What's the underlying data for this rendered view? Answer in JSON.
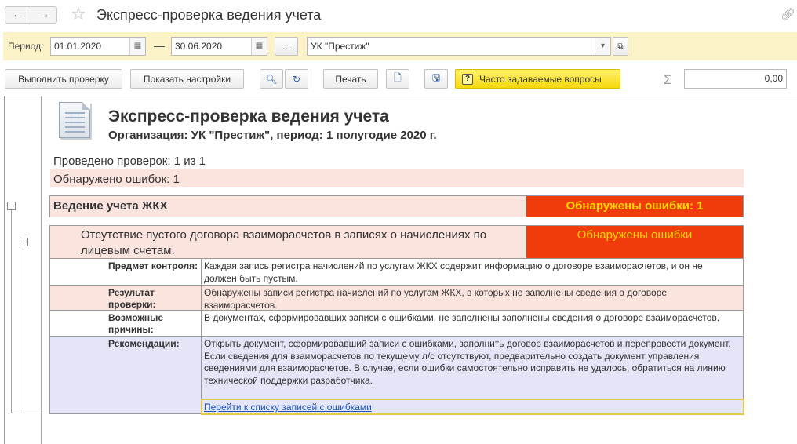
{
  "window": {
    "title": "Экспресс-проверка ведения учета"
  },
  "filter": {
    "period_label": "Период:",
    "date_from": "01.01.2020",
    "date_to": "30.06.2020",
    "dash": "—",
    "ellipsis_button": "...",
    "organization": "УК \"Престиж\""
  },
  "toolbar": {
    "run_check": "Выполнить проверку",
    "show_settings": "Показать настройки",
    "print": "Печать",
    "faq": "Часто задаваемые вопросы",
    "sum_value": "0,00"
  },
  "report": {
    "title": "Экспресс-проверка ведения учета",
    "org_line": "Организация: УК \"Престиж\", период: 1 полугодие 2020 г.",
    "checks_done": "Проведено проверок: 1 из 1",
    "errors_found": "Обнаружено ошибок: 1",
    "section": {
      "name": "Ведение учета ЖКХ",
      "status": "Обнаружены ошибки: 1"
    },
    "check": {
      "name": "Отсутствие пустого договора взаиморасчетов в записях о начислениях по лицевым счетам.",
      "status": "Обнаружены ошибки",
      "rows": [
        {
          "key": "Предмет контроля:",
          "value": "Каждая запись регистра начислений по услугам ЖКХ содержит информацию о договоре взаиморасчетов, и он не должен быть пустым."
        },
        {
          "key": "Результат проверки:",
          "value": "Обнаружены записи регистра начислений по услугам ЖКХ, в которых не заполнены сведения о договоре взаиморасчетов."
        },
        {
          "key": "Возможные причины:",
          "value": "В документах, сформировавших записи с ошибками, не заполнены заполнены сведения о договоре взаиморасчетов."
        },
        {
          "key": "Рекомендации:",
          "value": "Открыть документ, сформировавший записи с ошибками, заполнить договор взаиморасчетов и перепровести документ. Если сведения для взаиморасчетов по текущему л/с отсутствуют, предварительно создать документ управления сведениями для взаиморасчетов. В случае, если ошибки самостоятельно исправить не удалось, обратиться на линию технической поддержки разработчика."
        }
      ],
      "link": "Перейти к списку записей с ошибками"
    }
  },
  "colors": {
    "filter_bg": "#fbf3c7",
    "error_bg": "#f03b0b",
    "error_text": "#ffd800",
    "pink_row": "#fbe4de",
    "recommend_bg": "#e4e5f7"
  }
}
